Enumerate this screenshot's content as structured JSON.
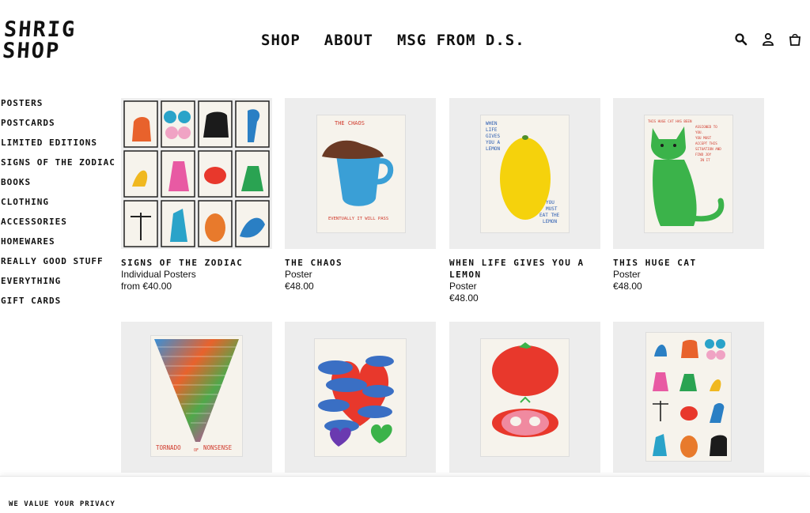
{
  "logo": {
    "line1": "SHRIG",
    "line2": "SHOP"
  },
  "nav": {
    "shop": "SHOP",
    "about": "ABOUT",
    "msg": "MSG FROM D.S."
  },
  "header_icons": [
    "search-icon",
    "account-icon",
    "cart-icon"
  ],
  "sidebar": {
    "items": [
      {
        "label": "POSTERS"
      },
      {
        "label": "POSTCARDS"
      },
      {
        "label": "LIMITED EDITIONS"
      },
      {
        "label": "SIGNS OF THE ZODIAC"
      },
      {
        "label": "BOOKS"
      },
      {
        "label": "CLOTHING"
      },
      {
        "label": "ACCESSORIES"
      },
      {
        "label": "HOMEWARES"
      },
      {
        "label": "REALLY GOOD STUFF"
      },
      {
        "label": "EVERYTHING"
      },
      {
        "label": "GIFT CARDS"
      }
    ]
  },
  "products": [
    {
      "title": "SIGNS OF THE ZODIAC",
      "subtitle": "Individual Posters",
      "price": "from €40.00"
    },
    {
      "title": "THE CHAOS",
      "subtitle": "Poster",
      "price": "€48.00"
    },
    {
      "title": "WHEN LIFE GIVES YOU A LEMON",
      "subtitle": "Poster",
      "price": "€48.00"
    },
    {
      "title": "THIS HUGE CAT",
      "subtitle": "Poster",
      "price": "€48.00"
    }
  ],
  "art_text": {
    "chaos_top": "THE CHAOS",
    "chaos_bottom": "EVENTUALLY IT WILL PASS",
    "lemon_top": [
      "WHEN",
      "LIFE",
      "GIVES",
      "YOU A",
      "LEMON"
    ],
    "lemon_bottom": [
      "YOU",
      "MUST",
      "EAT THE",
      "LEMON"
    ],
    "cat_text": [
      "THIS HUGE CAT HAS BEEN",
      "ASSIGNED TO",
      "YOU.",
      "YOU MUST",
      "ACCEPT THIS",
      "SITUATION AND",
      "FIND JOY",
      "IN IT"
    ],
    "tornado_left": "TORNADO",
    "tornado_mid": "OF",
    "tornado_right": "NONSENSE"
  },
  "privacy_banner": "WE VALUE YOUR PRIVACY",
  "colors": {
    "card_bg": "#ededed",
    "text": "#111111"
  }
}
